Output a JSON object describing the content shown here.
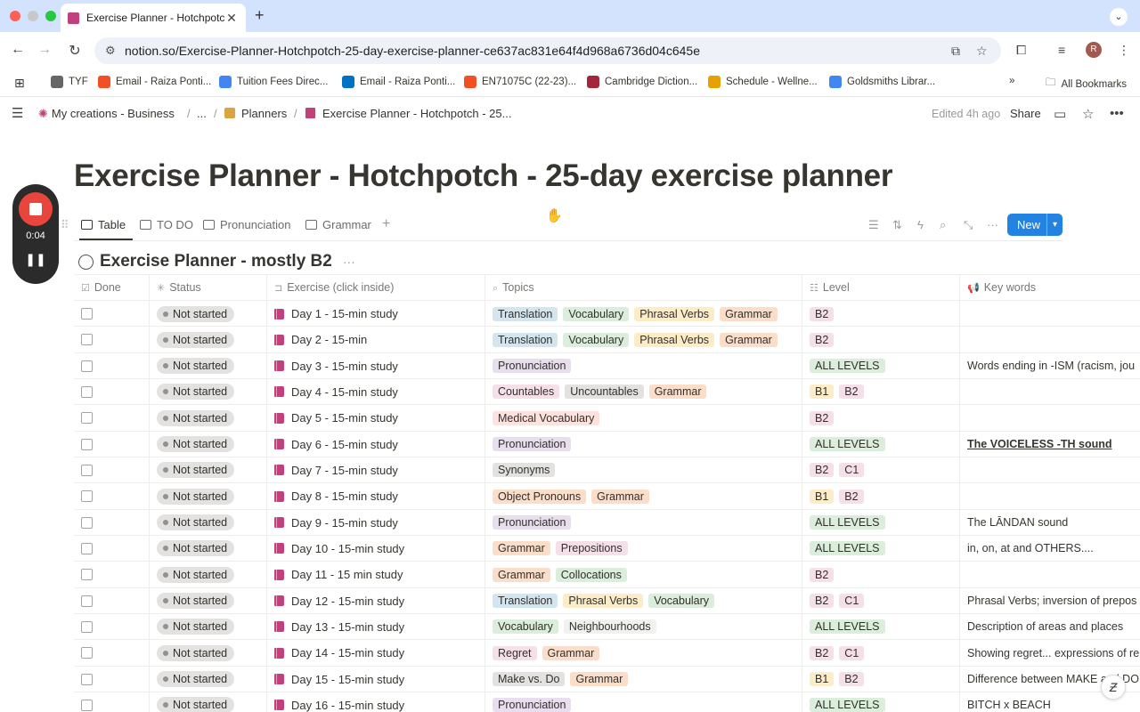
{
  "browser": {
    "tab_title": "Exercise Planner - Hotchpotch",
    "new_tab": "+",
    "url": "notion.so/Exercise-Planner-Hotchpotch-25-day-exercise-planner-ce637ac831e64f4d968a6736d04c645e",
    "avatar": "R",
    "bookmarks": [
      {
        "label": "TYF",
        "color": "#666666"
      },
      {
        "label": "Email - Raiza Ponti...",
        "color": "#f25022"
      },
      {
        "label": "Tuition Fees Direc...",
        "color": "#4285f4"
      },
      {
        "label": "Email - Raiza Ponti...",
        "color": "#0072c6"
      },
      {
        "label": "EN71075C (22-23)...",
        "color": "#f25022"
      },
      {
        "label": "Cambridge Diction...",
        "color": "#a3263b"
      },
      {
        "label": "Schedule - Wellne...",
        "color": "#e6a100"
      },
      {
        "label": "Goldsmiths Librar...",
        "color": "#4285f4"
      }
    ],
    "bookmarks_more": "»",
    "all_bookmarks": "All Bookmarks"
  },
  "notion": {
    "breadcrumbs": [
      "My creations - Business",
      "...",
      "Planners",
      "Exercise Planner - Hotchpotch - 25..."
    ],
    "edited": "Edited 4h ago",
    "share": "Share",
    "page_title": "Exercise Planner - Hotchpotch - 25-day exercise planner",
    "views": [
      "Table",
      "TO DO",
      "Pronunciation",
      "Grammar"
    ],
    "add_view": "+",
    "new_button": "New",
    "database_title": "Exercise Planner - mostly B2",
    "db_menu": "···",
    "columns": [
      "Done",
      "Status",
      "Exercise (click inside)",
      "Topics",
      "Level",
      "Key words"
    ]
  },
  "recorder": {
    "time": "0:04"
  },
  "tag_colors": {
    "Translation": "#d3e5ef",
    "Vocabulary": "#dbeddb",
    "Phrasal Verbs": "#fdecc8",
    "Grammar": "#fadec9",
    "Pronunciation": "#e8deee",
    "Countables": "#f5e0e9",
    "Uncountables": "#e3e2e0",
    "Medical Vocabulary": "#ffe2dd",
    "Synonyms": "#e3e2e0",
    "Object Pronouns": "#fadec9",
    "Prepositions": "#f5e0e9",
    "Collocations": "#dbeddb",
    "Neighbourhoods": "#f1f1ef",
    "Regret": "#f5e0e9",
    "Make vs. Do": "#e3e2e0",
    "B2": "#f5e0e9",
    "C1": "#f5e0e9",
    "B1": "#fdecc8",
    "ALL LEVELS": "#dbeddb"
  },
  "rows": [
    {
      "status": "Not started",
      "exercise": "Day 1 - 15-min study",
      "topics": [
        "Translation",
        "Vocabulary",
        "Phrasal Verbs",
        "Grammar"
      ],
      "level": [
        "B2"
      ],
      "keywords": ""
    },
    {
      "status": "Not started",
      "exercise": "Day 2 - 15-min",
      "topics": [
        "Translation",
        "Vocabulary",
        "Phrasal Verbs",
        "Grammar"
      ],
      "level": [
        "B2"
      ],
      "keywords": ""
    },
    {
      "status": "Not started",
      "exercise": "Day 3 - 15-min study",
      "topics": [
        "Pronunciation"
      ],
      "level": [
        "ALL LEVELS"
      ],
      "keywords": "Words ending in -ISM (racism, jou"
    },
    {
      "status": "Not started",
      "exercise": "Day 4 - 15-min study",
      "topics": [
        "Countables",
        "Uncountables",
        "Grammar"
      ],
      "level": [
        "B1",
        "B2"
      ],
      "keywords": ""
    },
    {
      "status": "Not started",
      "exercise": "Day 5 - 15-min study",
      "topics": [
        "Medical Vocabulary"
      ],
      "level": [
        "B2"
      ],
      "keywords": ""
    },
    {
      "status": "Not started",
      "exercise": "Day 6 - 15-min study",
      "topics": [
        "Pronunciation"
      ],
      "level": [
        "ALL LEVELS"
      ],
      "keywords": "The VOICELESS -TH sound",
      "kw_bold": true
    },
    {
      "status": "Not started",
      "exercise": "Day 7 - 15-min study",
      "topics": [
        "Synonyms"
      ],
      "level": [
        "B2",
        "C1"
      ],
      "keywords": ""
    },
    {
      "status": "Not started",
      "exercise": "Day 8 - 15-min study",
      "topics": [
        "Object Pronouns",
        "Grammar"
      ],
      "level": [
        "B1",
        "B2"
      ],
      "keywords": ""
    },
    {
      "status": "Not started",
      "exercise": "Day 9 - 15-min study",
      "topics": [
        "Pronunciation"
      ],
      "level": [
        "ALL LEVELS"
      ],
      "keywords": "The LĀNDAN sound"
    },
    {
      "status": "Not started",
      "exercise": "Day 10 - 15-min study",
      "topics": [
        "Grammar",
        "Prepositions"
      ],
      "level": [
        "ALL LEVELS"
      ],
      "keywords": "in, on, at and OTHERS....",
      "kw_italic_prefix": true
    },
    {
      "status": "Not started",
      "exercise": "Day 11 - 15 min study",
      "topics": [
        "Grammar",
        "Collocations"
      ],
      "level": [
        "B2"
      ],
      "keywords": ""
    },
    {
      "status": "Not started",
      "exercise": "Day 12 - 15-min study",
      "topics": [
        "Translation",
        "Phrasal Verbs",
        "Vocabulary"
      ],
      "level": [
        "B2",
        "C1"
      ],
      "keywords": "Phrasal Verbs; inversion of prepos"
    },
    {
      "status": "Not started",
      "exercise": "Day 13 - 15-min study",
      "topics": [
        "Vocabulary",
        "Neighbourhoods"
      ],
      "level": [
        "ALL LEVELS"
      ],
      "keywords": "Description of areas and places"
    },
    {
      "status": "Not started",
      "exercise": "Day 14 - 15-min study",
      "topics": [
        "Regret",
        "Grammar"
      ],
      "level": [
        "B2",
        "C1"
      ],
      "keywords": "Showing regret... expressions of re"
    },
    {
      "status": "Not started",
      "exercise": "Day 15 - 15-min study",
      "topics": [
        "Make vs. Do",
        "Grammar"
      ],
      "level": [
        "B1",
        "B2"
      ],
      "keywords": "Difference between MAKE and DO"
    },
    {
      "status": "Not started",
      "exercise": "Day 16 - 15-min study",
      "topics": [
        "Pronunciation"
      ],
      "level": [
        "ALL LEVELS"
      ],
      "keywords": "BITCH x BEACH"
    }
  ]
}
